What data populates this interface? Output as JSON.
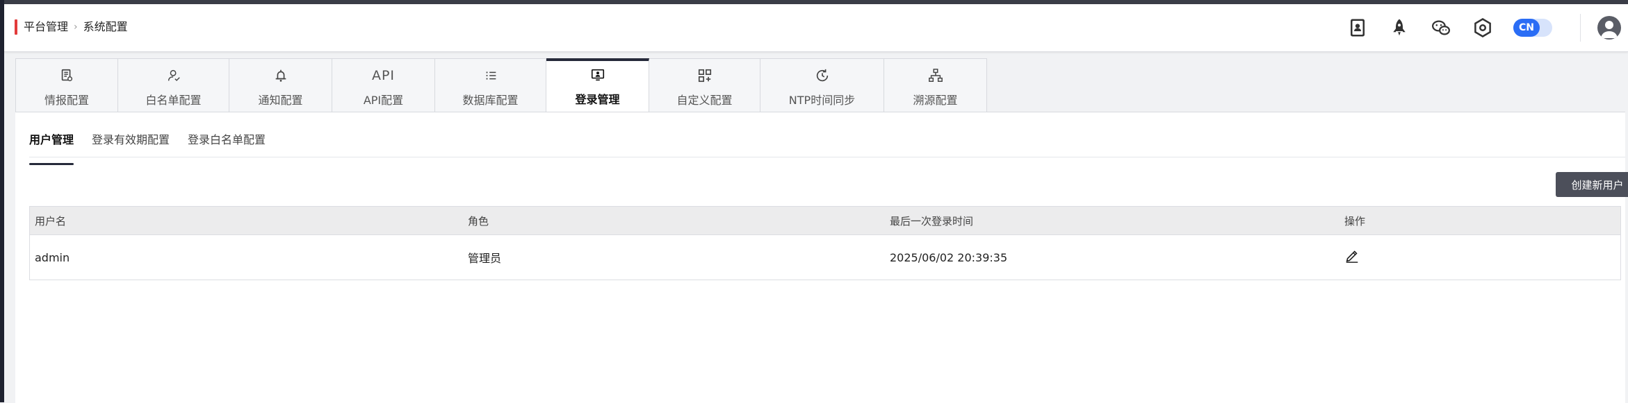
{
  "breadcrumb": {
    "parent": "平台管理",
    "current": "系统配置"
  },
  "header_icons": [
    "contact-book-icon",
    "rocket-icon",
    "wechat-icon",
    "hexagon-settings-icon"
  ],
  "language_toggle": {
    "label": "CN",
    "accent": "#2a6df5"
  },
  "tabs": [
    {
      "label": "情报配置",
      "icon": "report-icon"
    },
    {
      "label": "白名单配置",
      "icon": "user-check-icon"
    },
    {
      "label": "通知配置",
      "icon": "bell-icon"
    },
    {
      "label": "API配置",
      "icon": "api-icon",
      "icon_text": "API"
    },
    {
      "label": "数据库配置",
      "icon": "database-list-icon"
    },
    {
      "label": "登录管理",
      "icon": "login-monitor-icon",
      "active": true
    },
    {
      "label": "自定义配置",
      "icon": "grid-plus-icon"
    },
    {
      "label": "NTP时间同步",
      "icon": "clock-sync-icon"
    },
    {
      "label": "溯源配置",
      "icon": "network-tree-icon"
    }
  ],
  "subtabs": [
    {
      "label": "用户管理",
      "active": true
    },
    {
      "label": "登录有效期配置"
    },
    {
      "label": "登录白名单配置"
    }
  ],
  "create_button": "创建新用户",
  "table": {
    "headers": [
      "用户名",
      "角色",
      "最后一次登录时间",
      "操作"
    ],
    "rows": [
      {
        "username": "admin",
        "role": "管理员",
        "last_login": "2025/06/02 20:39:35",
        "action_icon": "edit-icon"
      }
    ]
  }
}
